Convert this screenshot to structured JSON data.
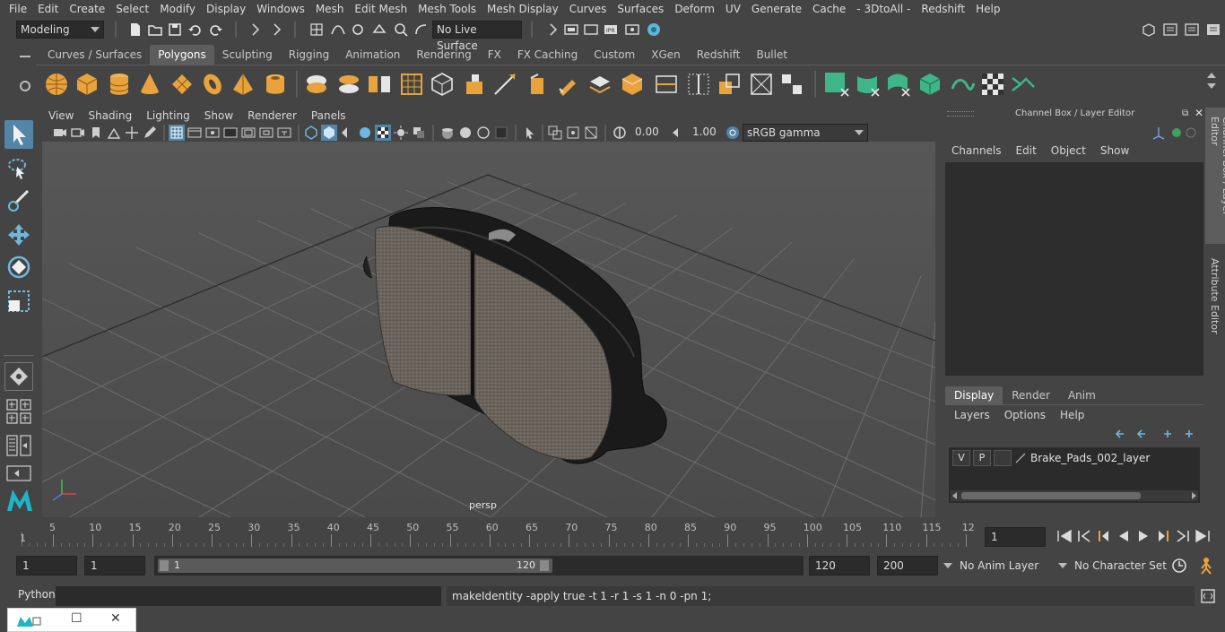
{
  "menubar": [
    "File",
    "Edit",
    "Create",
    "Select",
    "Modify",
    "Display",
    "Windows",
    "Mesh",
    "Edit Mesh",
    "Mesh Tools",
    "Mesh Display",
    "Curves",
    "Surfaces",
    "Deform",
    "UV",
    "Generate",
    "Cache",
    "- 3DtoAll -",
    "Redshift",
    "Help"
  ],
  "status": {
    "mode": "Modeling",
    "live_surface": "No Live Surface"
  },
  "shelf_tabs": [
    "Curves / Surfaces",
    "Polygons",
    "Sculpting",
    "Rigging",
    "Animation",
    "Rendering",
    "FX",
    "FX Caching",
    "Custom",
    "XGen",
    "Redshift",
    "Bullet"
  ],
  "shelf_active": "Polygons",
  "viewport": {
    "menu": [
      "View",
      "Shading",
      "Lighting",
      "Show",
      "Renderer",
      "Panels"
    ],
    "exposure": "0.00",
    "gamma": "1.00",
    "colorspace": "sRGB gamma",
    "camera_label": "persp"
  },
  "channel_box": {
    "title": "Channel Box / Layer Editor",
    "menu": [
      "Channels",
      "Edit",
      "Object",
      "Show"
    ],
    "side_tab_1": "Channel Box / Layer Editor",
    "side_tab_2": "Attribute Editor"
  },
  "layer_editor": {
    "tabs": [
      "Display",
      "Render",
      "Anim"
    ],
    "active_tab": "Display",
    "menu": [
      "Layers",
      "Options",
      "Help"
    ],
    "layer": {
      "v": "V",
      "p": "P",
      "name": "Brake_Pads_002_layer"
    }
  },
  "timeline": {
    "ticks": [
      "5",
      "10",
      "15",
      "20",
      "25",
      "30",
      "35",
      "40",
      "45",
      "50",
      "55",
      "60",
      "65",
      "70",
      "75",
      "80",
      "85",
      "90",
      "95",
      "100",
      "105",
      "110",
      "115",
      "12"
    ],
    "start_marker": "1",
    "current_frame": "1"
  },
  "range": {
    "start": "1",
    "playback_start": "1",
    "slider_start": "1",
    "slider_end": "120",
    "playback_end": "120",
    "end": "200",
    "anim_layer": "No Anim Layer",
    "character_set": "No Character Set"
  },
  "command": {
    "language": "Python",
    "output": "makeIdentity -apply true -t 1 -r 1 -s 1 -n 0 -pn 1;"
  },
  "colors": {
    "accent_orange": "#e8a33d",
    "accent_green": "#3fb58a",
    "active_tab": "#5d5d5d",
    "selection_blue": "#5285a6"
  }
}
